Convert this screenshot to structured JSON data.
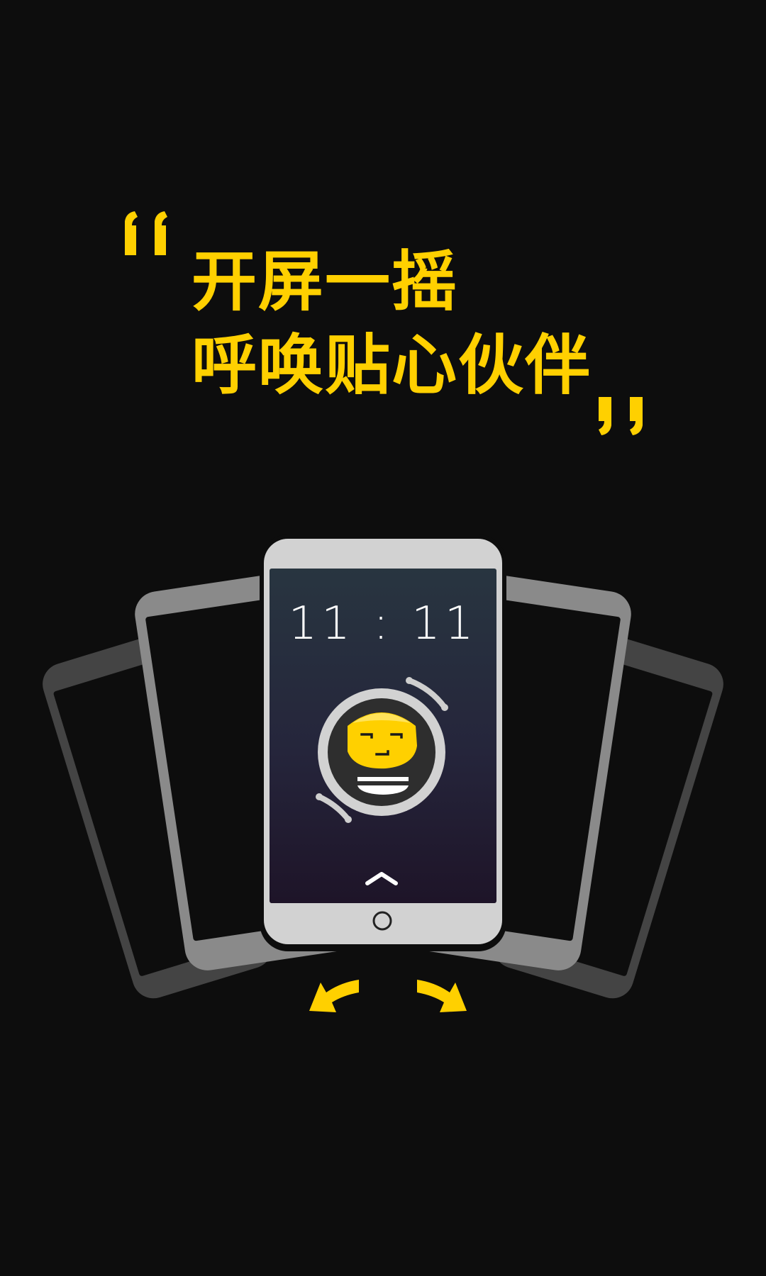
{
  "headline": {
    "line1": "开屏一摇",
    "line2": "呼唤贴心伙伴"
  },
  "lockscreen": {
    "time": "11 : 11"
  },
  "icons": {
    "quote_open": "left-double-quote-icon",
    "quote_close": "right-double-quote-icon",
    "mascot": "mascot-face-icon",
    "swipe_up": "chevron-up-icon",
    "home": "home-button-icon",
    "rotate_left": "rotate-left-arrow-icon",
    "rotate_right": "rotate-right-arrow-icon"
  },
  "colors": {
    "background": "#0d0d0d",
    "accent": "#ffd000",
    "phone_body": "#d2d2d2"
  }
}
